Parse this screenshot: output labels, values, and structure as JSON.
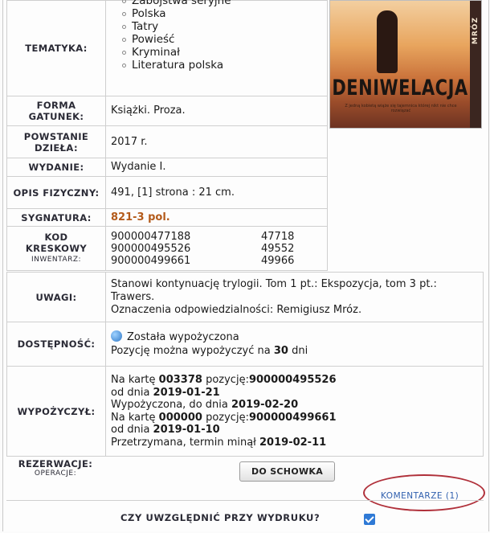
{
  "cover": {
    "title": "DENIWELACJA",
    "side_text": "MRÓZ",
    "blurb": "Z jedną kobietą wiąże się tajemnica której nikt nie chce rozwiązać"
  },
  "tematyka": {
    "label": "TEMATYKA:",
    "items": [
      "Zabójstwa seryjne",
      "Polska",
      "Tatry",
      "Powieść",
      "Kryminał",
      "Literatura polska"
    ]
  },
  "forma": {
    "label": "FORMA GATUNEK:",
    "value": "Książki. Proza."
  },
  "powstanie": {
    "label": "POWSTANIE DZIEŁA:",
    "value": "2017 r."
  },
  "wydanie": {
    "label": "WYDANIE:",
    "value": "Wydanie I."
  },
  "opis": {
    "label": "OPIS FIZYCZNY:",
    "value": "491, [1] strona : 21 cm."
  },
  "sygnatura": {
    "label": "SYGNATURA:",
    "value": "821-3 pol."
  },
  "kod": {
    "label_main": "KOD KRESKOWY",
    "label_sub": "INWENTARZ:",
    "rows": [
      {
        "barcode": "900000477188",
        "inv": "47718"
      },
      {
        "barcode": "900000495526",
        "inv": "49552"
      },
      {
        "barcode": "900000499661",
        "inv": "49966"
      }
    ]
  },
  "uwagi": {
    "label": "UWAGI:",
    "line1": "Stanowi kontynuację trylogii. Tom 1 pt.: Ekspozycja, tom 3 pt.: Trawers.",
    "line2": "Oznaczenia odpowiedzialności: Remigiusz Mróz."
  },
  "dostepnosc": {
    "label": "DOSTĘPNOŚĆ:",
    "status": "Została wypożyczona",
    "info_prefix": "Pozycję można wypożyczyć na ",
    "days": "30",
    "info_suffix": " dni"
  },
  "wypozyczyl": {
    "label": "WYPOŻYCZYŁ:",
    "l1_prefix": "Na kartę ",
    "l1_card": "003378",
    "l1_mid": " pozycję:",
    "l1_item": "900000495526",
    "l2_prefix": "od dnia ",
    "l2_date": "2019-01-21",
    "l3_prefix": "Wypożyczona, do dnia ",
    "l3_date": "2019-02-20",
    "l4_prefix": "Na kartę ",
    "l4_card": "000000",
    "l4_mid": " pozycję:",
    "l4_item": "900000499661",
    "l5_prefix": "od dnia ",
    "l5_date": "2019-01-10",
    "l6_prefix": "Przetrzymana, termin minął ",
    "l6_date": "2019-02-11"
  },
  "rezerwacje": {
    "label": "REZERWACJE:",
    "sub": "OPERACJE:",
    "button": "DO SCHOWKA"
  },
  "komentarze": {
    "label": "KOMENTARZE (1)"
  },
  "druk": {
    "label": "CZY UWZGLĘDNIĆ PRZY WYDRUKU?"
  }
}
